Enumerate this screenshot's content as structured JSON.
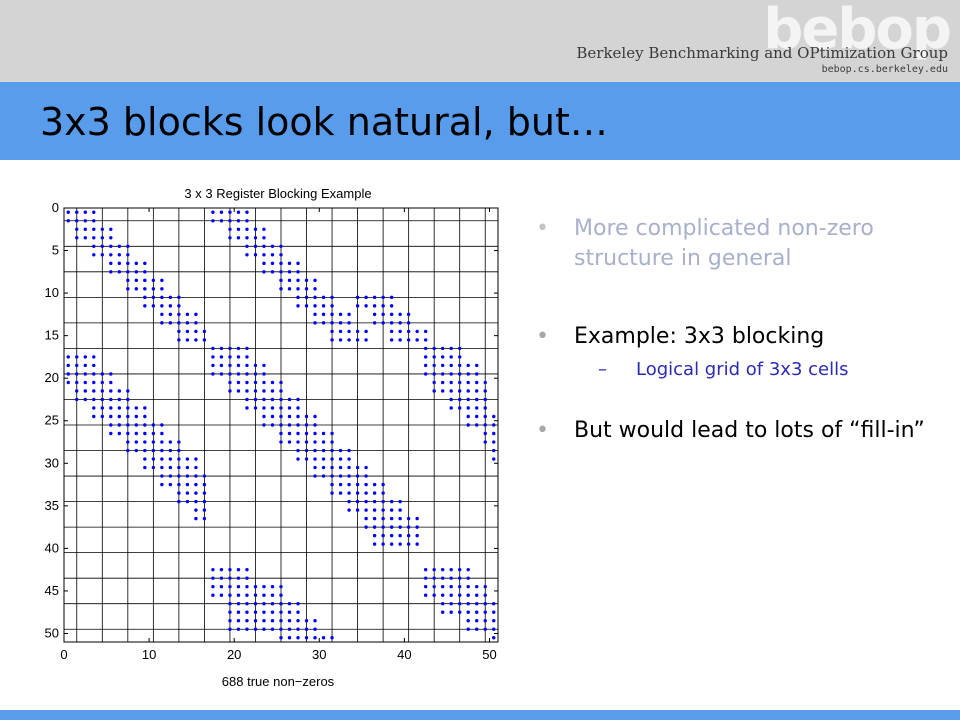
{
  "header": {
    "logo_text": "bebop",
    "group_name": "Berkeley Benchmarking and OPtimization Group",
    "url": "bebop.cs.berkeley.edu",
    "band_color": "#d4d4d4"
  },
  "slide": {
    "title": "3x3 blocks look natural, but…",
    "accent_color": "#599ceb"
  },
  "bullets": [
    {
      "text": "More complicated non-zero structure in general"
    },
    {
      "text": "Example: 3x3 blocking",
      "sub": "Logical grid of 3x3 cells"
    },
    {
      "text": "But would lead to lots of “fill-in”"
    }
  ],
  "chart_data": {
    "type": "scatter",
    "title": "3 x 3 Register Blocking Example",
    "xlabel": "688 true non−zeros",
    "ylabel": "",
    "xlim": [
      0,
      51
    ],
    "ylim": [
      51,
      0
    ],
    "xticks": [
      0,
      10,
      20,
      30,
      40,
      50
    ],
    "yticks": [
      0,
      5,
      10,
      15,
      20,
      25,
      30,
      35,
      40,
      45,
      50
    ],
    "grid": "3x3 cell grid",
    "marker": "dot",
    "color": "#0000ff",
    "nonzero_blocks": [
      {
        "rows": [
          0,
          1
        ],
        "cols": [
          0,
          1,
          2,
          3
        ]
      },
      {
        "rows": [
          2,
          3
        ],
        "cols": [
          1,
          2,
          3,
          4,
          5
        ]
      },
      {
        "rows": [
          4,
          5
        ],
        "cols": [
          3,
          4,
          5,
          6,
          7
        ]
      },
      {
        "rows": [
          6,
          7
        ],
        "cols": [
          5,
          6,
          7,
          8,
          9
        ]
      },
      {
        "rows": [
          8,
          9
        ],
        "cols": [
          7,
          8,
          9,
          10,
          11
        ]
      },
      {
        "rows": [
          10,
          11
        ],
        "cols": [
          9,
          10,
          11,
          12,
          13
        ]
      },
      {
        "rows": [
          12,
          13
        ],
        "cols": [
          11,
          12,
          13,
          14,
          15
        ]
      },
      {
        "rows": [
          14,
          15
        ],
        "cols": [
          13,
          14,
          15,
          16
        ]
      },
      {
        "rows": [
          0,
          1
        ],
        "cols": [
          17,
          18,
          19,
          20,
          21
        ]
      },
      {
        "rows": [
          2,
          3
        ],
        "cols": [
          19,
          20,
          21,
          22,
          23
        ]
      },
      {
        "rows": [
          4,
          5
        ],
        "cols": [
          21,
          22,
          23,
          24,
          25
        ]
      },
      {
        "rows": [
          6,
          7
        ],
        "cols": [
          23,
          24,
          25,
          26,
          27
        ]
      },
      {
        "rows": [
          8,
          9
        ],
        "cols": [
          25,
          26,
          27,
          28,
          29
        ]
      },
      {
        "rows": [
          10,
          11
        ],
        "cols": [
          27,
          28,
          29,
          30,
          31
        ]
      },
      {
        "rows": [
          12,
          13
        ],
        "cols": [
          29,
          30,
          31,
          32,
          33
        ]
      },
      {
        "rows": [
          14,
          15
        ],
        "cols": [
          31,
          32,
          33,
          34,
          35
        ]
      },
      {
        "rows": [
          10,
          11
        ],
        "cols": [
          34,
          35,
          36,
          37,
          38
        ]
      },
      {
        "rows": [
          12,
          13
        ],
        "cols": [
          36,
          37,
          38,
          39,
          40
        ]
      },
      {
        "rows": [
          14,
          15
        ],
        "cols": [
          38,
          39,
          40,
          41,
          42
        ]
      },
      {
        "rows": [
          17,
          18
        ],
        "cols": [
          0,
          1,
          2,
          3
        ]
      },
      {
        "rows": [
          19,
          20
        ],
        "cols": [
          0,
          1,
          2,
          3,
          4,
          5
        ]
      },
      {
        "rows": [
          21,
          22
        ],
        "cols": [
          1,
          2,
          3,
          4,
          5,
          6,
          7
        ]
      },
      {
        "rows": [
          23,
          24
        ],
        "cols": [
          3,
          4,
          5,
          6,
          7,
          8,
          9
        ]
      },
      {
        "rows": [
          25,
          26
        ],
        "cols": [
          5,
          6,
          7,
          8,
          9,
          10,
          11
        ]
      },
      {
        "rows": [
          27,
          28
        ],
        "cols": [
          7,
          8,
          9,
          10,
          11,
          12,
          13
        ]
      },
      {
        "rows": [
          29,
          30
        ],
        "cols": [
          9,
          10,
          11,
          12,
          13,
          14,
          15
        ]
      },
      {
        "rows": [
          31,
          32
        ],
        "cols": [
          11,
          12,
          13,
          14,
          15,
          16
        ]
      },
      {
        "rows": [
          33,
          34
        ],
        "cols": [
          13,
          14,
          15,
          16
        ]
      },
      {
        "rows": [
          35,
          36
        ],
        "cols": [
          15,
          16
        ]
      },
      {
        "rows": [
          16,
          17
        ],
        "cols": [
          17,
          18,
          19,
          20,
          21
        ]
      },
      {
        "rows": [
          18,
          19
        ],
        "cols": [
          17,
          18,
          19,
          20,
          21,
          22,
          23
        ]
      },
      {
        "rows": [
          20,
          21
        ],
        "cols": [
          19,
          20,
          21,
          22,
          23,
          24,
          25
        ]
      },
      {
        "rows": [
          22,
          23
        ],
        "cols": [
          21,
          22,
          23,
          24,
          25,
          26,
          27
        ]
      },
      {
        "rows": [
          24,
          25
        ],
        "cols": [
          23,
          24,
          25,
          26,
          27,
          28,
          29
        ]
      },
      {
        "rows": [
          26,
          27
        ],
        "cols": [
          25,
          26,
          27,
          28,
          29,
          30,
          31
        ]
      },
      {
        "rows": [
          28,
          29
        ],
        "cols": [
          27,
          28,
          29,
          30,
          31,
          32,
          33
        ]
      },
      {
        "rows": [
          30,
          31
        ],
        "cols": [
          29,
          30,
          31,
          32,
          33,
          34,
          35
        ]
      },
      {
        "rows": [
          32,
          33
        ],
        "cols": [
          31,
          32,
          33,
          34,
          35,
          36,
          37
        ]
      },
      {
        "rows": [
          34,
          35
        ],
        "cols": [
          33,
          34,
          35,
          36,
          37,
          38,
          39
        ]
      },
      {
        "rows": [
          36,
          37
        ],
        "cols": [
          35,
          36,
          37,
          38,
          39,
          40,
          41
        ]
      },
      {
        "rows": [
          38,
          39
        ],
        "cols": [
          36,
          37,
          38,
          39,
          40,
          41
        ]
      },
      {
        "rows": [
          16,
          17
        ],
        "cols": [
          42,
          43,
          44,
          45,
          46
        ]
      },
      {
        "rows": [
          18,
          19
        ],
        "cols": [
          42,
          43,
          44,
          45,
          46,
          47,
          48
        ]
      },
      {
        "rows": [
          20,
          21
        ],
        "cols": [
          43,
          44,
          45,
          46,
          47,
          48,
          49
        ]
      },
      {
        "rows": [
          22,
          23
        ],
        "cols": [
          45,
          46,
          47,
          48,
          49
        ]
      },
      {
        "rows": [
          24,
          25
        ],
        "cols": [
          47,
          48,
          49,
          50
        ]
      },
      {
        "rows": [
          26,
          27
        ],
        "cols": [
          49,
          50
        ]
      },
      {
        "rows": [
          28,
          29
        ],
        "cols": [
          50
        ]
      },
      {
        "rows": [
          42,
          43
        ],
        "cols": [
          17,
          18,
          19,
          20,
          21
        ]
      },
      {
        "rows": [
          44,
          45
        ],
        "cols": [
          17,
          18,
          19,
          20,
          21,
          22,
          23,
          24,
          25
        ]
      },
      {
        "rows": [
          46,
          47
        ],
        "cols": [
          19,
          20,
          21,
          22,
          23,
          24,
          25,
          26,
          27
        ]
      },
      {
        "rows": [
          48,
          49
        ],
        "cols": [
          19,
          20,
          21,
          22,
          23,
          24,
          25,
          26,
          27,
          28,
          29
        ]
      },
      {
        "rows": [
          50
        ],
        "cols": [
          25,
          26,
          27,
          28,
          29,
          30,
          31
        ]
      },
      {
        "rows": [
          42,
          43
        ],
        "cols": [
          42,
          43,
          44,
          45,
          46,
          47
        ]
      },
      {
        "rows": [
          44,
          45
        ],
        "cols": [
          42,
          43,
          44,
          45,
          46,
          47,
          48,
          49
        ]
      },
      {
        "rows": [
          46,
          47
        ],
        "cols": [
          44,
          45,
          46,
          47,
          48,
          49,
          50
        ]
      },
      {
        "rows": [
          48,
          49
        ],
        "cols": [
          47,
          48,
          49,
          50
        ]
      },
      {
        "rows": [
          50
        ],
        "cols": [
          50
        ]
      }
    ]
  }
}
